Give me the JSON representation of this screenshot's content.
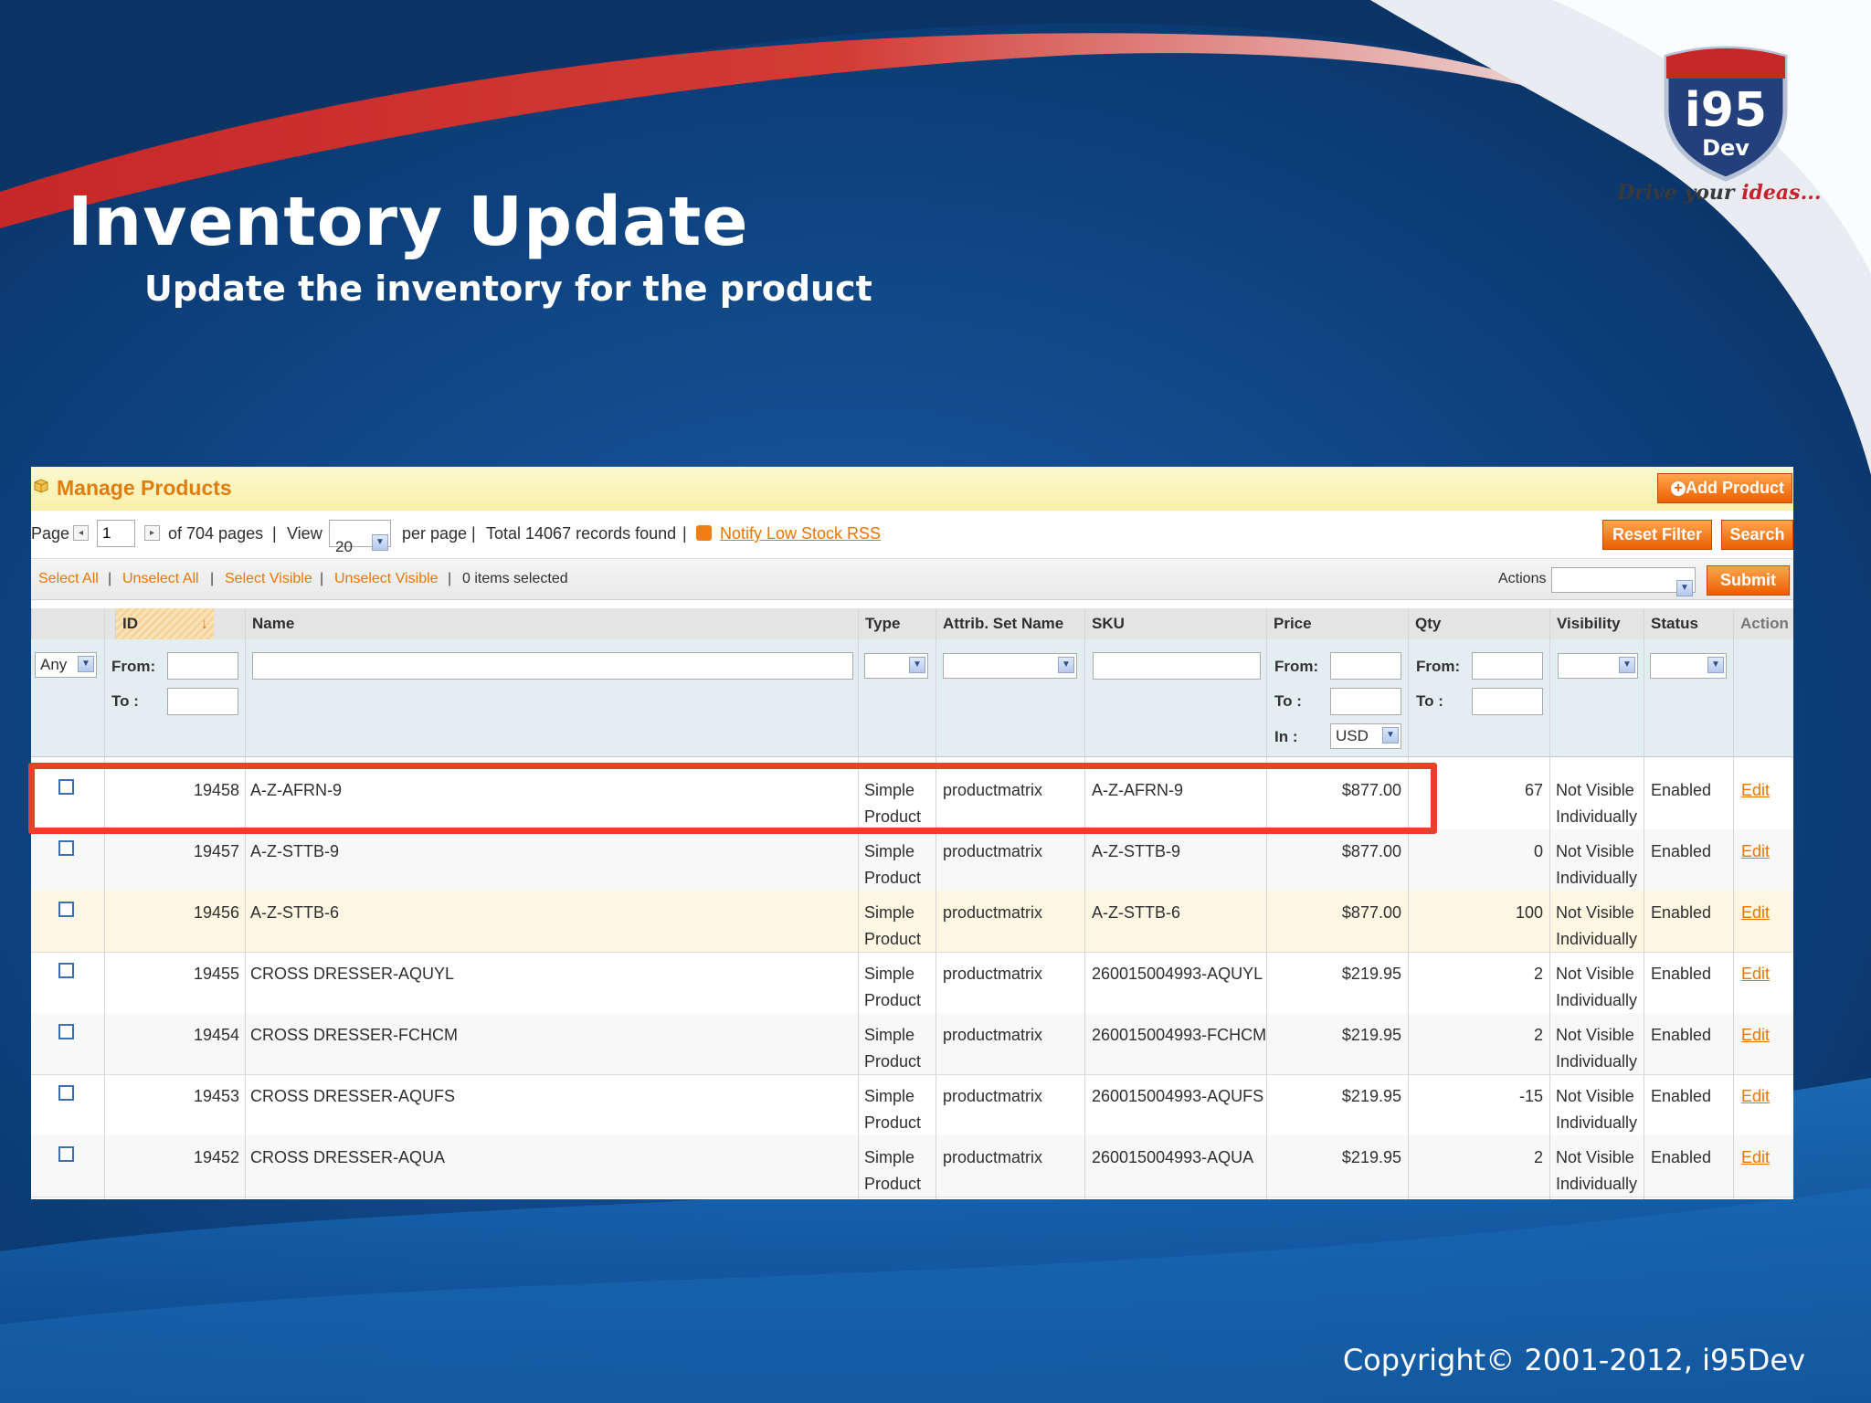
{
  "slide": {
    "title": "Inventory Update",
    "subtitle": "Update the inventory for the product",
    "copyright": "Copyright©  2001-2012, i95Dev"
  },
  "logo": {
    "text_main": "i95",
    "text_sub": "Dev",
    "tagline_a": "Drive your",
    "tagline_b": "ideas..."
  },
  "colors": {
    "accent": "#eb5e00",
    "link": "#ea7601",
    "callout": "#e8402a",
    "slide_bg": "#0d3f7a"
  },
  "panel": {
    "heading": "Manage Products",
    "add_product_label": "Add Product",
    "pager": {
      "page_label": "Page",
      "page_value": "1",
      "of_pages": "of 704 pages",
      "sep": "|",
      "view_label": "View",
      "per_page_value": "20",
      "per_page_label": "per page",
      "total_records": "Total 14067 records found",
      "rss_link": "Notify Low Stock RSS",
      "reset_filter": "Reset Filter",
      "search": "Search"
    },
    "massbar": {
      "select_all": "Select All",
      "unselect_all": "Unselect All",
      "select_visible": "Select Visible",
      "unselect_visible": "Unselect Visible",
      "items_selected": "0 items selected",
      "sep": "|",
      "actions_label": "Actions",
      "submit": "Submit"
    },
    "columns": {
      "id": "ID",
      "name": "Name",
      "type": "Type",
      "attrib_set": "Attrib. Set Name",
      "sku": "SKU",
      "price": "Price",
      "qty": "Qty",
      "visibility": "Visibility",
      "status": "Status",
      "action": "Action"
    },
    "filters": {
      "any": "Any",
      "from": "From:",
      "to": "To :",
      "in": "In :",
      "currency": "USD"
    },
    "rows": [
      {
        "id": "19458",
        "name": "A-Z-AFRN-9",
        "type_a": "Simple",
        "type_b": "Product",
        "attrib": "productmatrix",
        "sku": "A-Z-AFRN-9",
        "price": "$877.00",
        "qty": "67",
        "vis_a": "Not Visible",
        "vis_b": "Individually",
        "status": "Enabled",
        "action": "Edit"
      },
      {
        "id": "19457",
        "name": "A-Z-STTB-9",
        "type_a": "Simple",
        "type_b": "Product",
        "attrib": "productmatrix",
        "sku": "A-Z-STTB-9",
        "price": "$877.00",
        "qty": "0",
        "vis_a": "Not Visible",
        "vis_b": "Individually",
        "status": "Enabled",
        "action": "Edit"
      },
      {
        "id": "19456",
        "name": "A-Z-STTB-6",
        "type_a": "Simple",
        "type_b": "Product",
        "attrib": "productmatrix",
        "sku": "A-Z-STTB-6",
        "price": "$877.00",
        "qty": "100",
        "vis_a": "Not Visible",
        "vis_b": "Individually",
        "status": "Enabled",
        "action": "Edit"
      },
      {
        "id": "19455",
        "name": "CROSS DRESSER-AQUYL",
        "type_a": "Simple",
        "type_b": "Product",
        "attrib": "productmatrix",
        "sku": "260015004993-AQUYL",
        "price": "$219.95",
        "qty": "2",
        "vis_a": "Not Visible",
        "vis_b": "Individually",
        "status": "Enabled",
        "action": "Edit"
      },
      {
        "id": "19454",
        "name": "CROSS DRESSER-FCHCM",
        "type_a": "Simple",
        "type_b": "Product",
        "attrib": "productmatrix",
        "sku": "260015004993-FCHCM",
        "price": "$219.95",
        "qty": "2",
        "vis_a": "Not Visible",
        "vis_b": "Individually",
        "status": "Enabled",
        "action": "Edit"
      },
      {
        "id": "19453",
        "name": "CROSS DRESSER-AQUFS",
        "type_a": "Simple",
        "type_b": "Product",
        "attrib": "productmatrix",
        "sku": "260015004993-AQUFS",
        "price": "$219.95",
        "qty": "-15",
        "vis_a": "Not Visible",
        "vis_b": "Individually",
        "status": "Enabled",
        "action": "Edit"
      },
      {
        "id": "19452",
        "name": "CROSS DRESSER-AQUA",
        "type_a": "Simple",
        "type_b": "Product",
        "attrib": "productmatrix",
        "sku": "260015004993-AQUA",
        "price": "$219.95",
        "qty": "2",
        "vis_a": "Not Visible",
        "vis_b": "Individually",
        "status": "Enabled",
        "action": "Edit"
      }
    ]
  }
}
